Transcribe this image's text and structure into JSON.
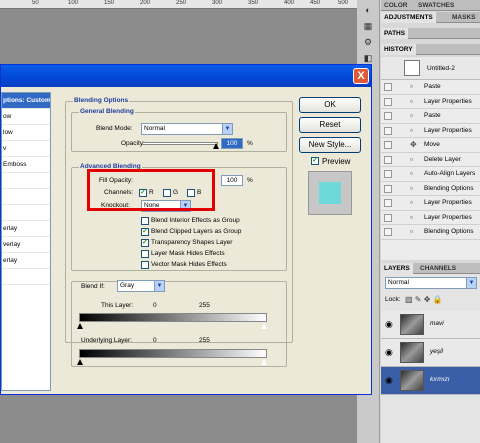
{
  "ruler": {
    "marks": [
      "50",
      "100",
      "150",
      "200",
      "250",
      "300",
      "350",
      "400",
      "450",
      "500"
    ]
  },
  "panels": {
    "top_tabs": [
      "COLOR",
      "SWATCHES"
    ],
    "adjustments_tabs": [
      "ADJUSTMENTS",
      "MASKS"
    ],
    "paths_tab": "PATHS",
    "history_tab": "HISTORY",
    "snapshot_name": "Untitled-2",
    "history_items": [
      "Paste",
      "Layer Properties",
      "Paste",
      "Layer Properties",
      "Move",
      "Delete Layer",
      "Auto-Align Layers",
      "Blending Options",
      "Layer Properties",
      "Layer Properties",
      "Blending Options"
    ],
    "layers_tabs": [
      "LAYERS",
      "CHANNELS"
    ],
    "blend_mode": "Normal",
    "lock_label": "Lock:",
    "layers": [
      {
        "name": "mavi"
      },
      {
        "name": "yeşil"
      },
      {
        "name": "kırmızı"
      }
    ]
  },
  "dialog": {
    "close_glyph": "X",
    "styles": [
      "ptions: Custom",
      "ow",
      "low",
      "v",
      "Emboss",
      "",
      "",
      "",
      "erlay",
      "verlay",
      "erlay",
      ""
    ],
    "blending_options_title": "Blending Options",
    "general_blending": "General Blending",
    "blend_mode_label": "Blend Mode:",
    "blend_mode_value": "Normal",
    "opacity_label": "Opacity:",
    "opacity_value": "100",
    "percent": "%",
    "advanced_blending": "Advanced Blending",
    "fill_opacity_label": "Fill Opacity:",
    "fill_opacity_value": "100",
    "channels_label": "Channels:",
    "channel_r": "R",
    "channel_g": "G",
    "channel_b": "B",
    "knockout_label": "Knockout:",
    "knockout_value": "None",
    "options": [
      {
        "label": "Blend Interior Effects as Group",
        "checked": false
      },
      {
        "label": "Blend Clipped Layers as Group",
        "checked": true
      },
      {
        "label": "Transparency Shapes Layer",
        "checked": true
      },
      {
        "label": "Layer Mask Hides Effects",
        "checked": false
      },
      {
        "label": "Vector Mask Hides Effects",
        "checked": false
      }
    ],
    "blend_if_label": "Blend If:",
    "blend_if_value": "Gray",
    "this_layer_label": "This Layer:",
    "this_layer_min": "0",
    "this_layer_max": "255",
    "underlying_label": "Underlying Layer:",
    "underlying_min": "0",
    "underlying_max": "255",
    "ok": "OK",
    "reset": "Reset",
    "new_style": "New Style...",
    "preview_label": "Preview",
    "preview_color": "#6fd8d8"
  }
}
